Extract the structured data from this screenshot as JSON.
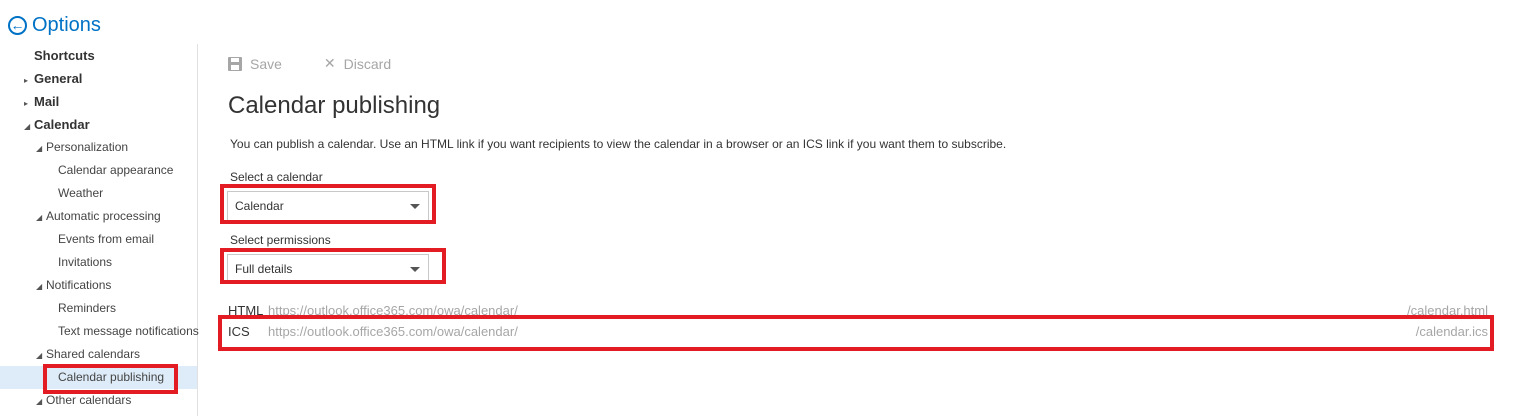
{
  "header": {
    "title": "Options"
  },
  "sidebar": {
    "items": [
      {
        "label": "Shortcuts",
        "caret": ""
      },
      {
        "label": "General",
        "caret": "▸"
      },
      {
        "label": "Mail",
        "caret": "▸"
      },
      {
        "label": "Calendar",
        "caret": "◢"
      },
      {
        "label": "Personalization",
        "caret": "◢"
      },
      {
        "label": "Calendar appearance",
        "caret": ""
      },
      {
        "label": "Weather",
        "caret": ""
      },
      {
        "label": "Automatic processing",
        "caret": "◢"
      },
      {
        "label": "Events from email",
        "caret": ""
      },
      {
        "label": "Invitations",
        "caret": ""
      },
      {
        "label": "Notifications",
        "caret": "◢"
      },
      {
        "label": "Reminders",
        "caret": ""
      },
      {
        "label": "Text message notifications",
        "caret": ""
      },
      {
        "label": "Shared calendars",
        "caret": "◢"
      },
      {
        "label": "Calendar publishing",
        "caret": ""
      },
      {
        "label": "Other calendars",
        "caret": "◢"
      }
    ]
  },
  "toolbar": {
    "save_label": "Save",
    "discard_label": "Discard"
  },
  "main": {
    "title": "Calendar publishing",
    "description": "You can publish a calendar. Use an HTML link if you want recipients to view the calendar in a browser or an ICS link if you want them to subscribe.",
    "calendar_select": {
      "label": "Select a calendar",
      "value": "Calendar"
    },
    "permissions_select": {
      "label": "Select permissions",
      "value": "Full details"
    },
    "links": [
      {
        "type": "HTML",
        "url": "https://outlook.office365.com/owa/calendar/",
        "suffix": "/calendar.html"
      },
      {
        "type": "ICS",
        "url": "https://outlook.office365.com/owa/calendar/",
        "suffix": "/calendar.ics"
      }
    ]
  },
  "colors": {
    "accent": "#0072c6",
    "highlight": "#e31b23",
    "selected_bg": "#deecf9"
  }
}
